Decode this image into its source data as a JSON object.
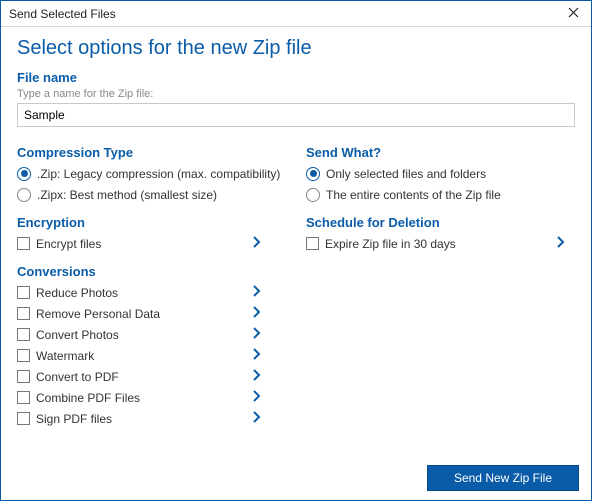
{
  "window": {
    "title": "Send Selected Files"
  },
  "page": {
    "heading": "Select options for the new Zip file"
  },
  "filename": {
    "heading": "File name",
    "hint": "Type a name for the Zip file:",
    "value": "Sample"
  },
  "compression": {
    "heading": "Compression Type",
    "options": [
      {
        "label": ".Zip: Legacy compression (max. compatibility)",
        "selected": true
      },
      {
        "label": ".Zipx: Best method (smallest size)",
        "selected": false
      }
    ]
  },
  "sendwhat": {
    "heading": "Send What?",
    "options": [
      {
        "label": "Only selected files and folders",
        "selected": true
      },
      {
        "label": "The entire contents of the Zip file",
        "selected": false
      }
    ]
  },
  "encryption": {
    "heading": "Encryption",
    "items": [
      {
        "label": "Encrypt files"
      }
    ]
  },
  "schedule": {
    "heading": "Schedule for Deletion",
    "items": [
      {
        "label": "Expire Zip file in 30 days"
      }
    ]
  },
  "conversions": {
    "heading": "Conversions",
    "items": [
      {
        "label": "Reduce Photos"
      },
      {
        "label": "Remove Personal Data"
      },
      {
        "label": "Convert Photos"
      },
      {
        "label": "Watermark"
      },
      {
        "label": "Convert to PDF"
      },
      {
        "label": "Combine PDF Files"
      },
      {
        "label": "Sign PDF files"
      }
    ]
  },
  "footer": {
    "primary": "Send New Zip File"
  }
}
